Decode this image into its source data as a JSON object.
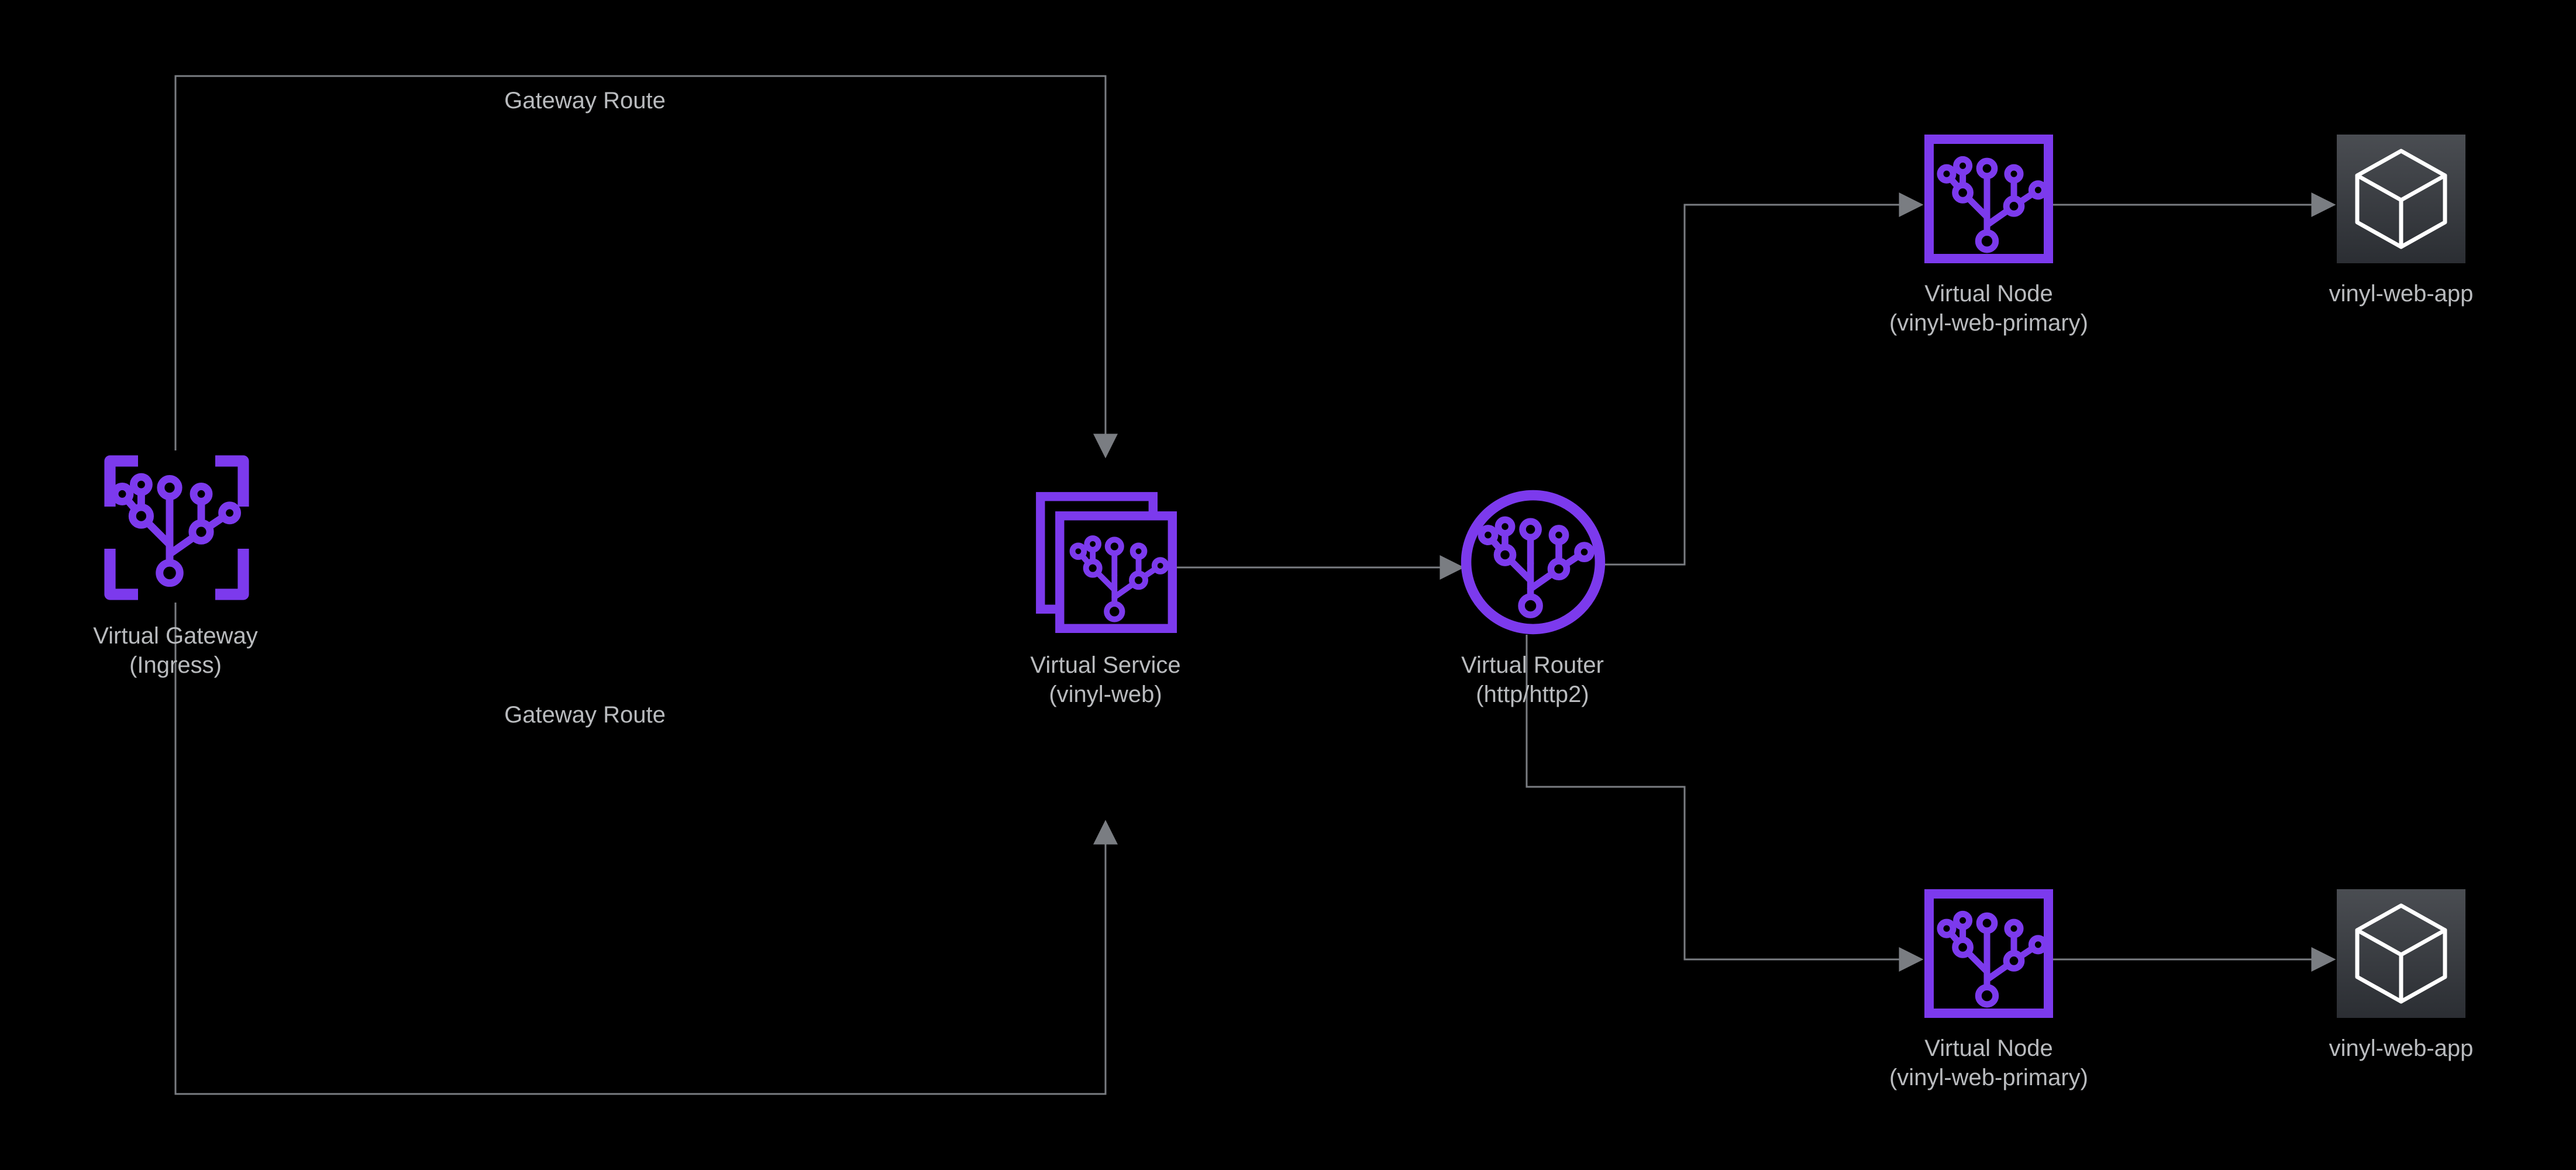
{
  "nodes": {
    "gateway": {
      "title": "Virtual Gateway",
      "sub": "(Ingress)"
    },
    "service": {
      "title": "Virtual Service",
      "sub": "(vinyl-web)"
    },
    "router": {
      "title": "Virtual Router",
      "sub": "(http/http2)"
    },
    "vnodeTop": {
      "title": "Virtual Node",
      "sub": "(vinyl-web-primary)"
    },
    "vnodeBot": {
      "title": "Virtual Node",
      "sub": "(vinyl-web-primary)"
    },
    "appTop": {
      "title": "vinyl-web-app"
    },
    "appBot": {
      "title": "vinyl-web-app"
    }
  },
  "edges": {
    "routeTop": "Gateway Route",
    "routeBot": "Gateway Route"
  },
  "colors": {
    "mesh": "#7c3aed",
    "label": "#b9bbbe",
    "edge": "#7a7d82",
    "boxFill": "#3c4043",
    "boxStroke": "#ffffff"
  }
}
